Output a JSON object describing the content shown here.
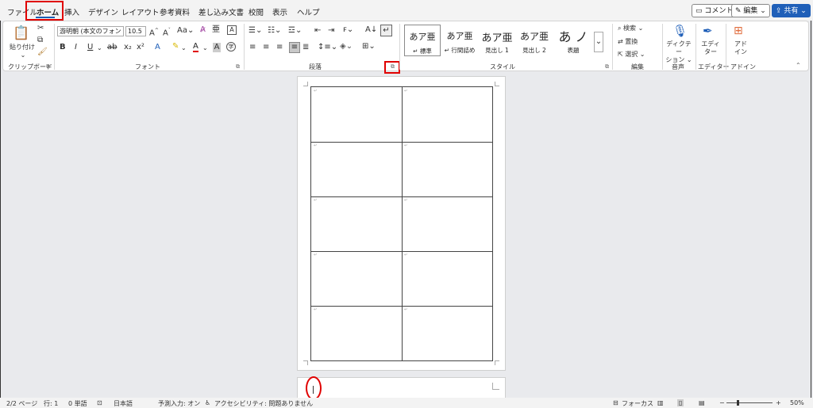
{
  "tabs": [
    "ファイル",
    "ホーム",
    "挿入",
    "デザイン",
    "レイアウト",
    "参考資料",
    "差し込み文書",
    "校閲",
    "表示",
    "ヘルプ"
  ],
  "top_buttons": {
    "comment": "コメント",
    "edit": "編集",
    "share": "共有"
  },
  "clipboard": {
    "paste": "貼り付け",
    "label": "クリップボード"
  },
  "font": {
    "name": "游明朝 (本文のフォント",
    "size": "10.5",
    "label": "フォント",
    "bold": "B",
    "italic": "I",
    "underline": "U",
    "strike": "ab",
    "sub": "x₂",
    "sup": "x²",
    "grow": "A^",
    "shrink": "Aˇ",
    "case": "Aa",
    "clear": "A",
    "box": "A",
    "highlight": "🖊",
    "color": "A",
    "effect": "A"
  },
  "paragraph": {
    "label": "段落"
  },
  "styles": {
    "label": "スタイル",
    "items": [
      {
        "sample": "あア亜",
        "name": "↵ 標準"
      },
      {
        "sample": "あア亜",
        "name": "↵ 行間詰め"
      },
      {
        "sample": "あア亜",
        "name": "見出し 1"
      },
      {
        "sample": "あア亜",
        "name": "見出し 2"
      },
      {
        "sample": "あ ノ",
        "name": "表題"
      }
    ]
  },
  "editing": {
    "label": "編集",
    "find": "検索",
    "replace": "置換",
    "select": "選択"
  },
  "voice": {
    "label": "音声",
    "dictate": "ディクテーション",
    "dictate_line1": "ディクテー",
    "dictate_line2": "ション"
  },
  "editor": {
    "label": "エディター",
    "line1": "エディ",
    "line2": "ター"
  },
  "addin": {
    "label": "アドイン",
    "line1": "アド",
    "line2": "イン"
  },
  "status": {
    "pages": "2/2 ページ",
    "line": "行: 1",
    "words": "0 単語",
    "lang": "日本語",
    "ime": "予測入力: オン",
    "accessibility": "アクセシビリティ: 問題ありません",
    "focus": "フォーカス",
    "zoom": "50%"
  },
  "accent": "#1f5fb8",
  "highlight_color": "#e00000"
}
